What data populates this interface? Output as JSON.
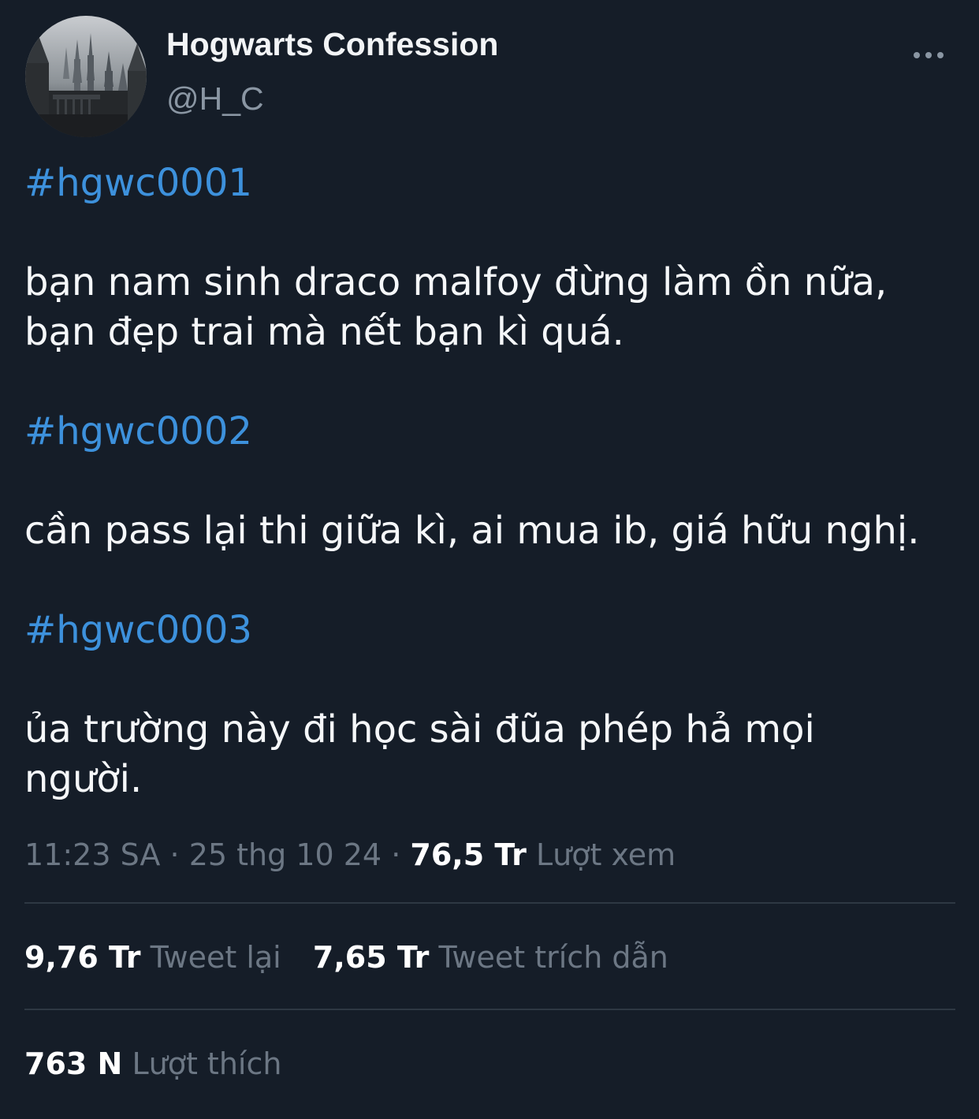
{
  "author": {
    "display_name": "Hogwarts Confession",
    "handle": "@H_C",
    "avatar_icon": "castle-photo"
  },
  "menu": {
    "icon": "more-icon"
  },
  "tweet": {
    "lines": [
      {
        "text": "#hgwc0001",
        "kind": "hashtag"
      },
      {
        "text": "bạn nam sinh draco malfoy đừng làm ồn nữa,",
        "kind": "text"
      },
      {
        "text": "bạn đẹp trai mà nết bạn kì quá.",
        "kind": "text"
      },
      {
        "text": "#hgwc0002",
        "kind": "hashtag"
      },
      {
        "text": "cần pass lại thi giữa kì, ai mua ib, giá hữu nghị.",
        "kind": "text"
      },
      {
        "text": "#hgwc0003",
        "kind": "hashtag"
      },
      {
        "text": "ủa trường này đi học sài đũa phép hả mọi",
        "kind": "text"
      },
      {
        "text": "người.",
        "kind": "text"
      }
    ]
  },
  "meta": {
    "time": "11:23 SA",
    "separator": "·",
    "date": "25 thg 10 24",
    "views_count": "76,5 Tr",
    "views_label": "Lượt xem"
  },
  "stats": {
    "retweets_count": "9,76 Tr",
    "retweets_label": "Tweet lại",
    "quotes_count": "7,65 Tr",
    "quotes_label": "Tweet trích dẫn",
    "likes_count": "763 N",
    "likes_label": "Lượt thích"
  },
  "colors": {
    "background": "#151d28",
    "hashtag": "#3d91dc",
    "muted": "#6c7784"
  }
}
